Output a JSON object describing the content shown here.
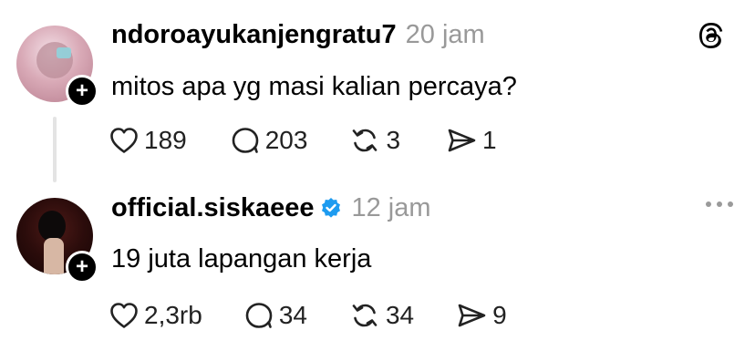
{
  "posts": [
    {
      "username": "ndoroayukanjengratu7",
      "verified": false,
      "time": "20 jam",
      "text": "mitos apa yg masi kalian percaya?",
      "likes": "189",
      "replies": "203",
      "reposts": "3",
      "shares": "1"
    },
    {
      "username": "official.siskaeee",
      "verified": true,
      "time": "12 jam",
      "text": "19 juta lapangan kerja",
      "likes": "2,3rb",
      "replies": "34",
      "reposts": "34",
      "shares": "9"
    }
  ],
  "icons": {
    "app_logo": "threads-logo-icon",
    "like": "heart-icon",
    "reply": "comment-icon",
    "repost": "repost-icon",
    "share": "send-icon",
    "follow": "plus-icon",
    "verified": "verified-badge-icon",
    "more": "more-icon"
  },
  "colors": {
    "verified": "#1d9bf0",
    "timestamp": "#999999",
    "thread_line": "#e4e4e4"
  }
}
